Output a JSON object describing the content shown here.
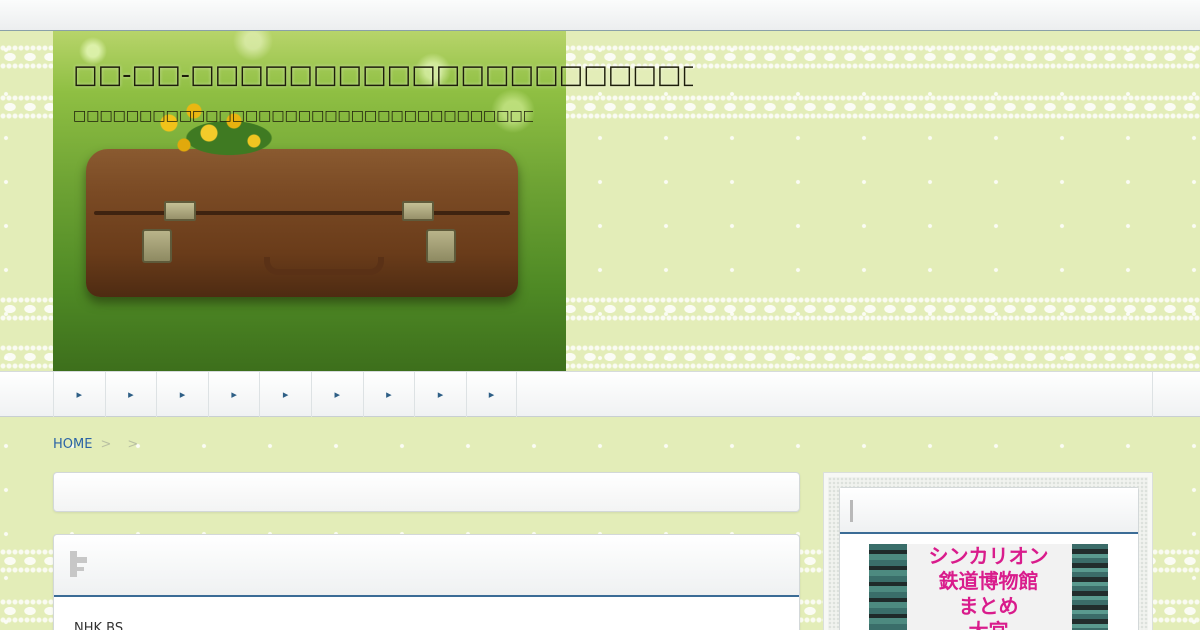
{
  "header": {
    "site_title": "□□-□□-□□□□□□□□□□□□□□□□□□□□□□□□□□□□□□□□□□□",
    "site_description": "□□□□□□□□□□□□□□□□□□□□□□□□□□□□□□□□□□□□□□□□□□□□□□□□□□□□□"
  },
  "nav": {
    "items": [
      {
        "label": "▸"
      },
      {
        "label": "▸"
      },
      {
        "label": "▸"
      },
      {
        "label": "▸"
      },
      {
        "label": "▸"
      },
      {
        "label": "▸"
      },
      {
        "label": "▸"
      },
      {
        "label": "▸"
      },
      {
        "label": "▸"
      }
    ]
  },
  "breadcrumb": {
    "home": "HOME",
    "sep1": ">",
    "sep2": ">"
  },
  "main": {
    "post_text": "NHK BS"
  },
  "sidebar": {
    "banner_lines": [
      "シンカリオン",
      "鉄道博物館",
      "まとめ",
      "大宮"
    ]
  },
  "colors": {
    "background": "#e3edb8",
    "link": "#2a63a6",
    "accent_border": "#3b6c96",
    "banner_text": "#d91c8c"
  }
}
